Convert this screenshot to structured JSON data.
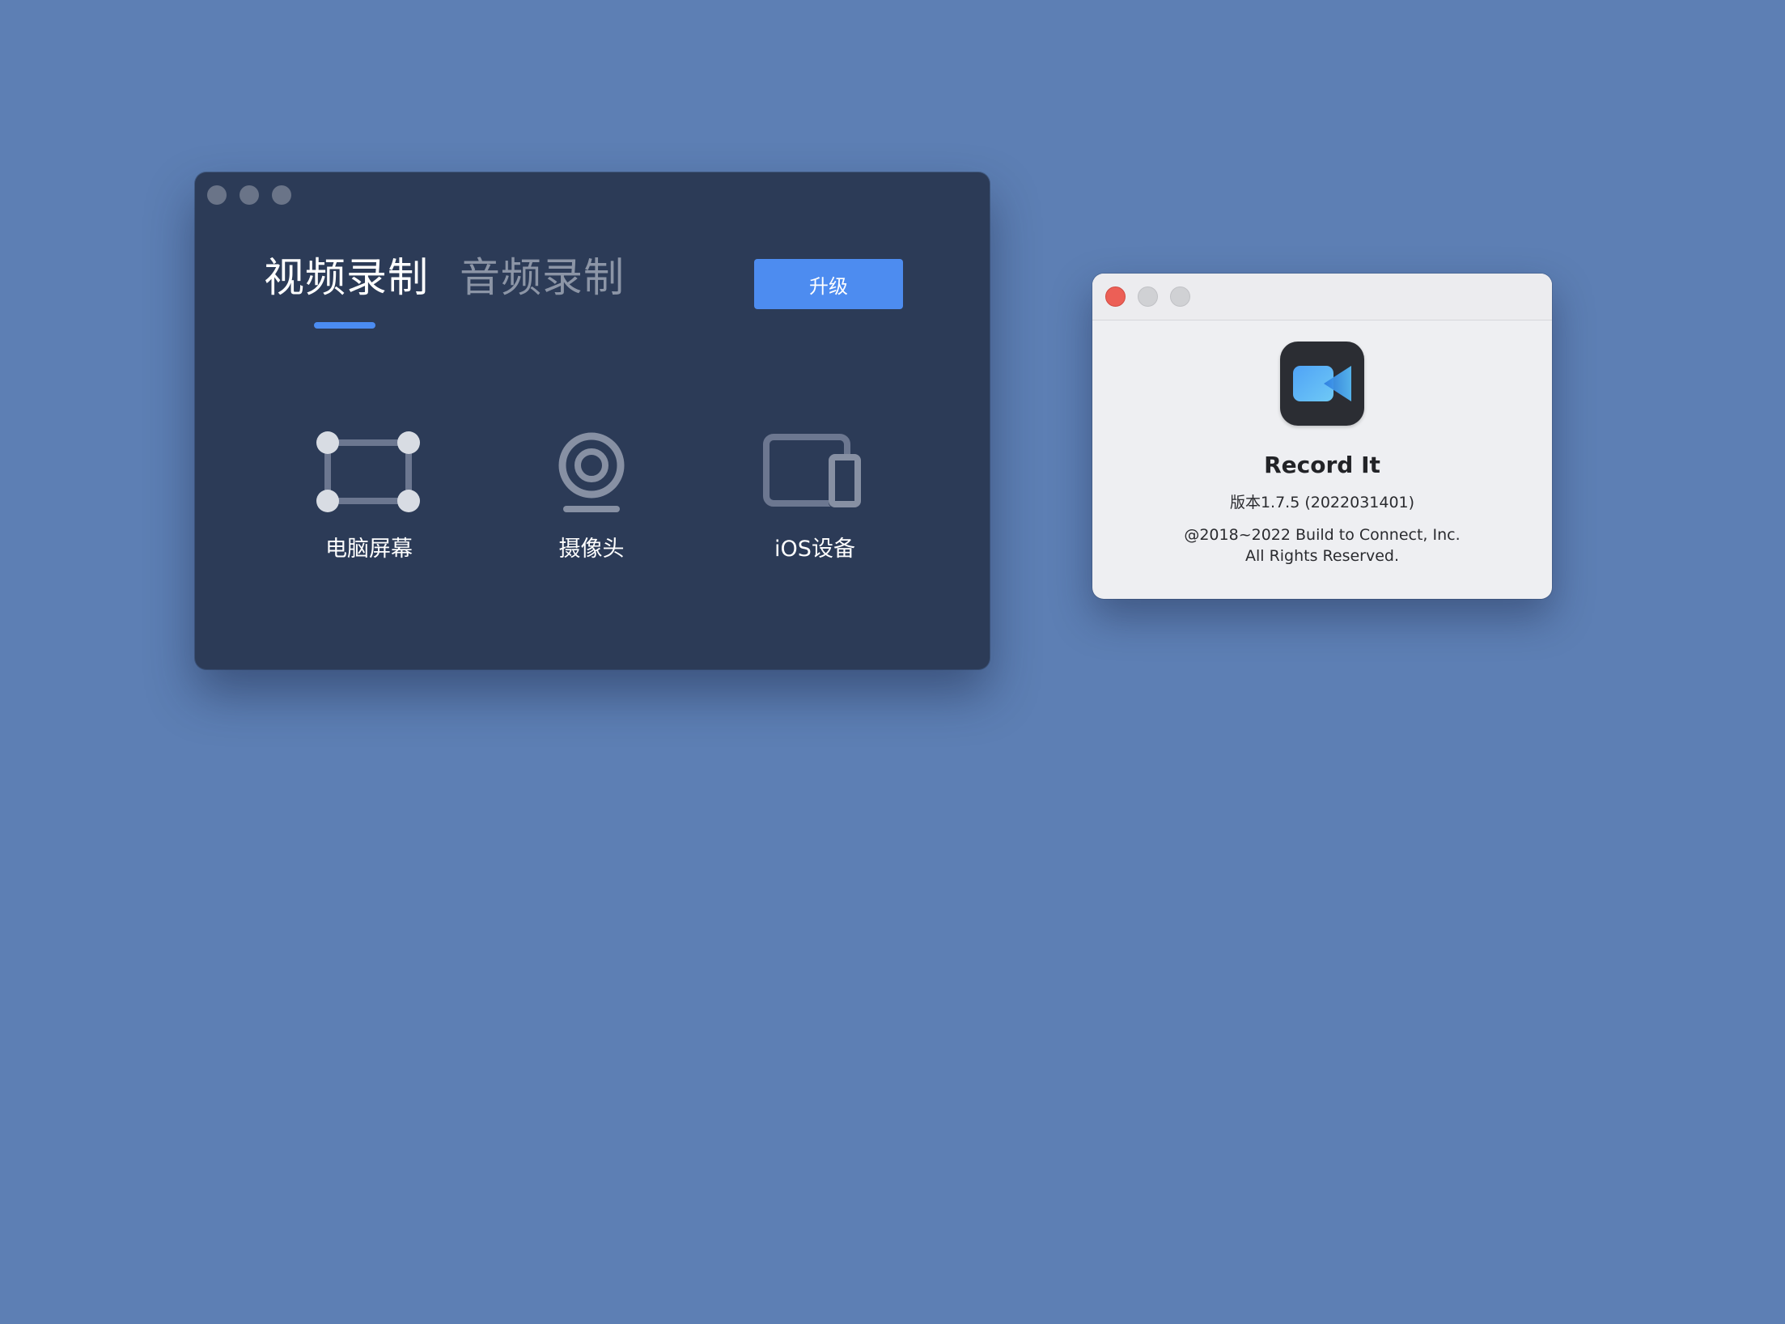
{
  "main_window": {
    "tabs": [
      {
        "label": "视频录制",
        "active": true
      },
      {
        "label": "音频录制",
        "active": false
      }
    ],
    "upgrade_label": "升级",
    "sources": [
      {
        "label": "电脑屏幕",
        "icon": "screen-capture-icon"
      },
      {
        "label": "摄像头",
        "icon": "webcam-icon"
      },
      {
        "label": "iOS设备",
        "icon": "ios-device-icon"
      }
    ]
  },
  "about_window": {
    "app_name": "Record It",
    "version": "版本1.7.5 (2022031401)",
    "copyright_line1": "@2018~2022 Build to Connect, Inc.",
    "copyright_line2": "All Rights Reserved.",
    "app_icon": "video-camera-icon"
  },
  "colors": {
    "desktop": "#5d7fb4",
    "main_window_bg": "#2c3b57",
    "accent": "#4d8cf0",
    "about_bg": "#eeeff2",
    "close_button": "#ec5f56"
  }
}
